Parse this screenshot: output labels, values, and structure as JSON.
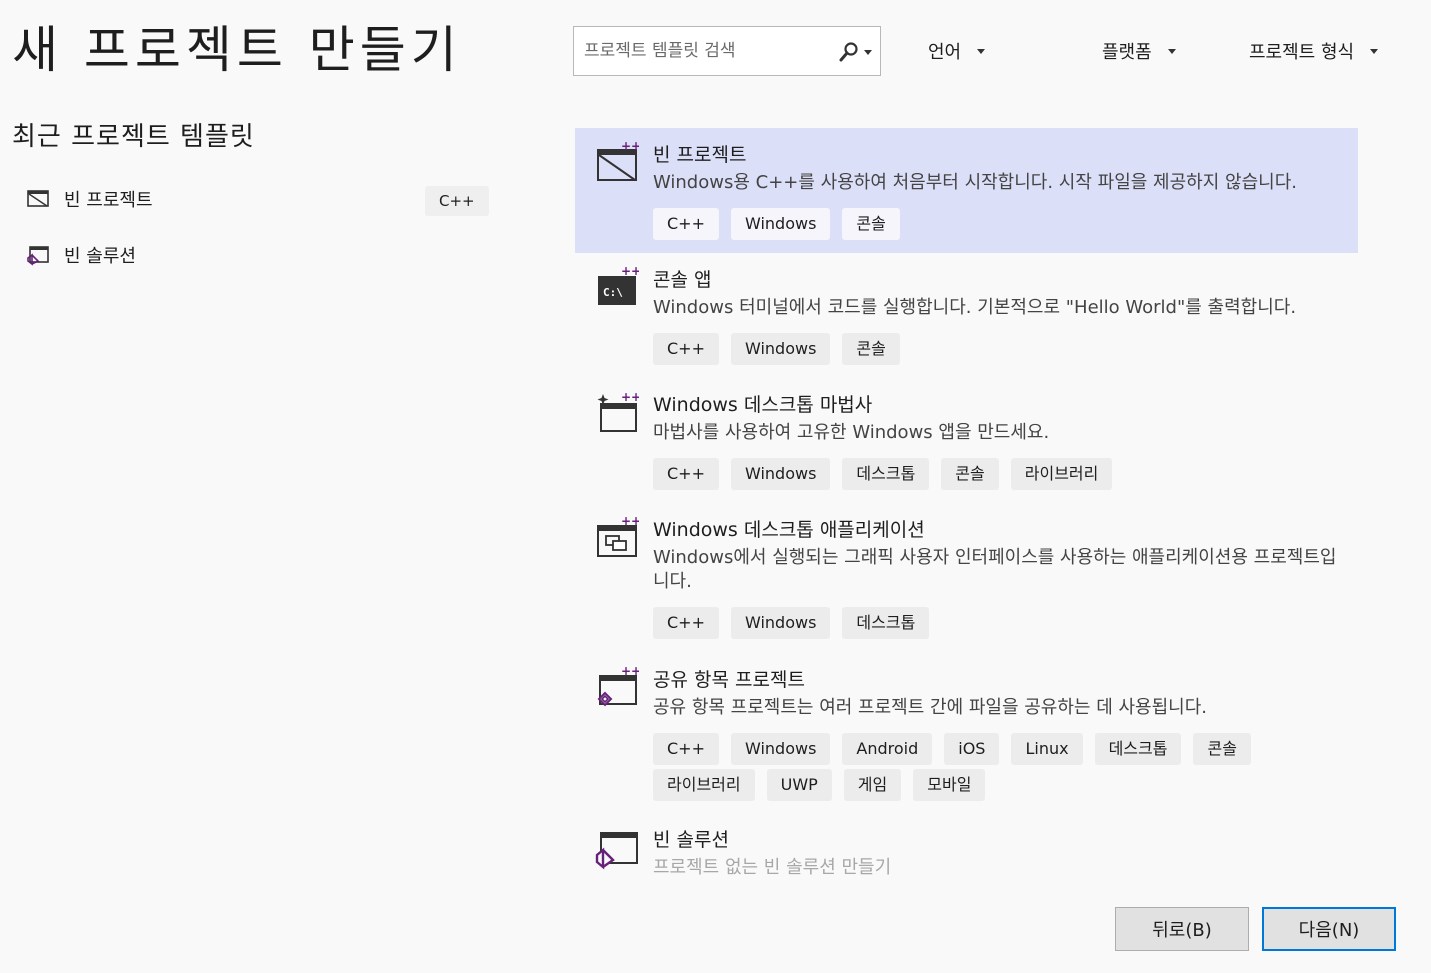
{
  "header": {
    "title": "새 프로젝트 만들기"
  },
  "search": {
    "placeholder": "프로젝트 템플릿 검색"
  },
  "filters": {
    "language": "언어",
    "platform": "플랫폼",
    "project_type": "프로젝트 형식"
  },
  "recent": {
    "heading": "최근 프로젝트 템플릿",
    "items": [
      {
        "label": "빈 프로젝트",
        "tag": "C++",
        "icon": "empty-project-icon"
      },
      {
        "label": "빈 솔루션",
        "tag": "",
        "icon": "blank-solution-icon"
      }
    ]
  },
  "templates": [
    {
      "title": "빈 프로젝트",
      "description": "Windows용 C++를 사용하여 처음부터 시작합니다. 시작 파일을 제공하지 않습니다.",
      "tags": [
        "C++",
        "Windows",
        "콘솔"
      ],
      "icon": "empty-project-icon",
      "selected": true
    },
    {
      "title": "콘솔 앱",
      "description": "Windows 터미널에서 코드를 실행합니다. 기본적으로 \"Hello World\"를 출력합니다.",
      "tags": [
        "C++",
        "Windows",
        "콘솔"
      ],
      "icon": "console-app-icon"
    },
    {
      "title": "Windows 데스크톱 마법사",
      "description": "마법사를 사용하여 고유한 Windows 앱을 만드세요.",
      "tags": [
        "C++",
        "Windows",
        "데스크톱",
        "콘솔",
        "라이브러리"
      ],
      "icon": "desktop-wizard-icon"
    },
    {
      "title": "Windows 데스크톱 애플리케이션",
      "description": "Windows에서 실행되는 그래픽 사용자 인터페이스를 사용하는 애플리케이션용 프로젝트입니다.",
      "tags": [
        "C++",
        "Windows",
        "데스크톱"
      ],
      "icon": "desktop-application-icon"
    },
    {
      "title": "공유 항목 프로젝트",
      "description": "공유 항목 프로젝트는 여러 프로젝트 간에 파일을 공유하는 데 사용됩니다.",
      "tags": [
        "C++",
        "Windows",
        "Android",
        "iOS",
        "Linux",
        "데스크톱",
        "콘솔",
        "라이브러리",
        "UWP",
        "게임",
        "모바일"
      ],
      "icon": "shared-items-icon"
    },
    {
      "title": "빈 솔루션",
      "description": "프로젝트 없는 빈 솔루션 만들기",
      "tags": [],
      "icon": "blank-solution-icon"
    }
  ],
  "footer": {
    "back_label": "뒤로(B)",
    "next_label": "다음(N)"
  },
  "colors": {
    "selected_bg": "#dcdff8",
    "accent": "#0078d7",
    "vs_purple": "#68217a"
  }
}
